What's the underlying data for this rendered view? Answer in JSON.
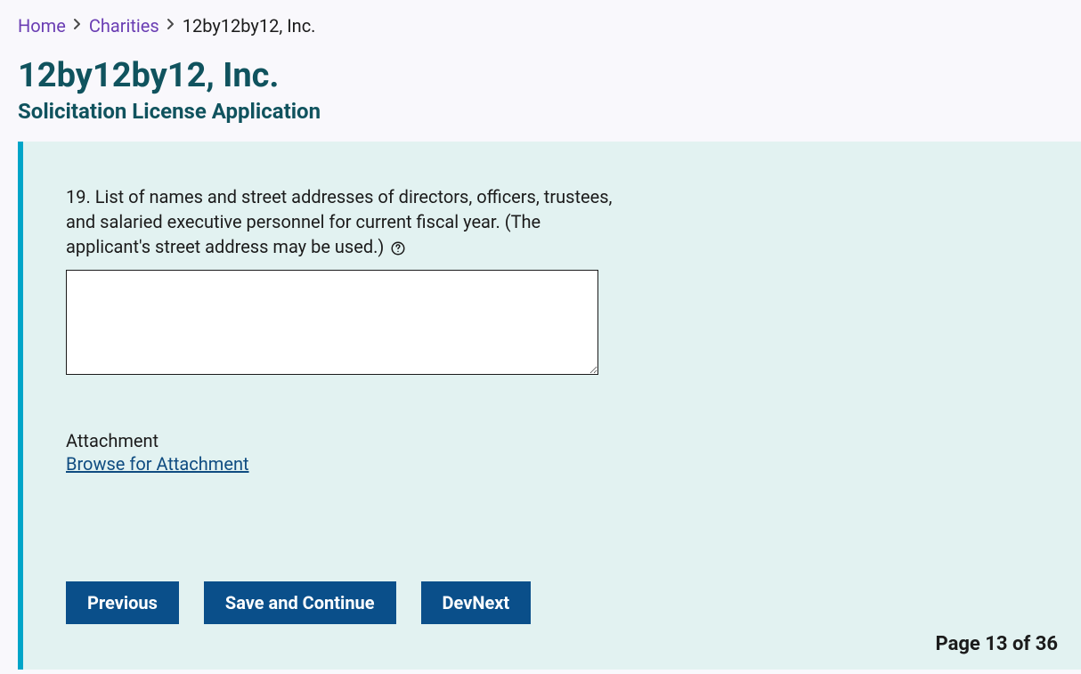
{
  "breadcrumb": {
    "home": "Home",
    "charities": "Charities",
    "current": "12by12by12, Inc."
  },
  "header": {
    "title": "12by12by12, Inc.",
    "subtitle": "Solicitation License Application"
  },
  "form": {
    "question_text": "19. List of names and street addresses of directors, officers, trustees, and salaried executive personnel for current fiscal year. (The applicant's street address may be used.)",
    "textarea_value": "",
    "attachment_label": "Attachment",
    "browse_label": "Browse for Attachment"
  },
  "buttons": {
    "previous": "Previous",
    "save_continue": "Save and Continue",
    "devnext": "DevNext"
  },
  "pager": {
    "text": "Page 13 of 36"
  }
}
